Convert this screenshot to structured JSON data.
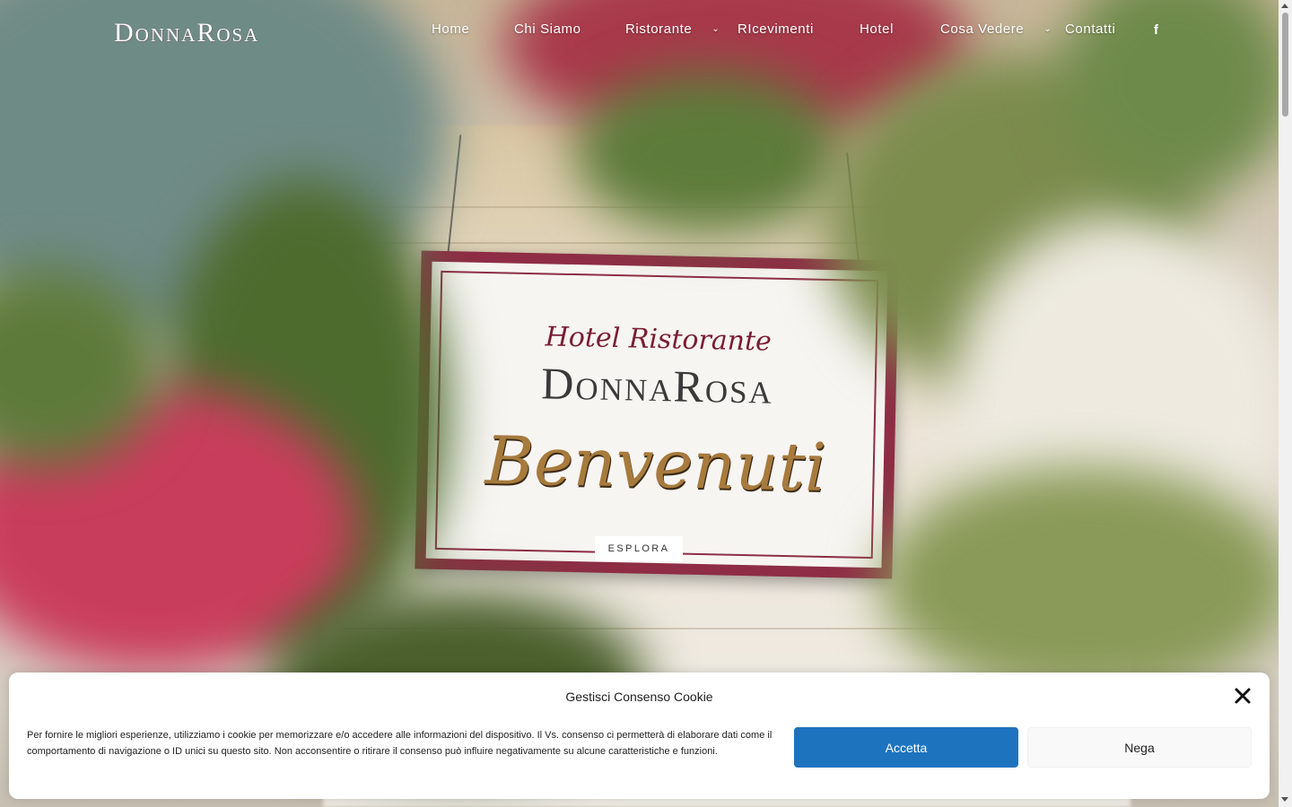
{
  "header": {
    "logo": "DonnaRosa",
    "nav": [
      {
        "label": "Home",
        "has_dropdown": false
      },
      {
        "label": "Chi Siamo",
        "has_dropdown": false
      },
      {
        "label": "Ristorante",
        "has_dropdown": true
      },
      {
        "label": "RIcevimenti",
        "has_dropdown": false
      },
      {
        "label": "Hotel",
        "has_dropdown": false
      },
      {
        "label": "Cosa Vedere",
        "has_dropdown": true
      },
      {
        "label": "Contatti",
        "has_dropdown": false
      }
    ],
    "social_icon": "facebook-icon",
    "social_glyph": "f"
  },
  "hero": {
    "sign_line1": "Hotel Ristorante",
    "sign_line2": "DonnaRosa",
    "sign_line3": "Benvenuti",
    "explore_label": "ESPLORA"
  },
  "cookie": {
    "title": "Gestisci Consenso Cookie",
    "text": "Per fornire le migliori esperienze, utilizziamo i cookie per memorizzare e/o accedere alle informazioni del dispositivo. Il Vs. consenso ci permetterà di elaborare dati come il comportamento di navigazione o ID unici su questo sito. Non acconsentire o ritirare il consenso può influire negativamente su alcune caratteristiche e funzioni.",
    "accept_label": "Accetta",
    "deny_label": "Nega",
    "accent_color": "#1e73be"
  }
}
